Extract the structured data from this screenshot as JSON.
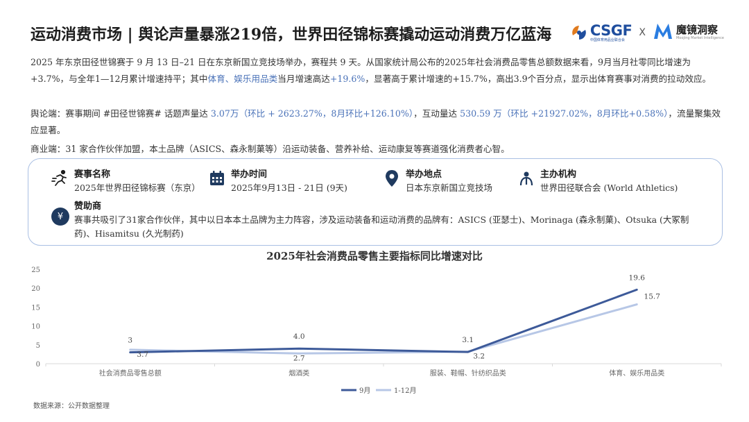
{
  "header": {
    "title": "运动消费市场 | 舆论声量暴涨219倍，世界田径锦标赛撬动运动消费万亿蓝海",
    "logo_csgf": "CSGF",
    "logo_csgf_sub": "中国体育用品业联合会",
    "logo_x": "X",
    "logo_moojing": "魔镜洞察",
    "logo_moojing_sub": "Moojing Market Intelligence",
    "brand_color": "#1f4e9e"
  },
  "paragraphs": {
    "p1_a": "2025 年东京田径世锦赛于 9 月 13 日–21 日在东京新国立竞技场举办，赛程共 9 天。从国家统计局公布的2025年社会消费品零售总额数据来看，9月当月社零同比增速为+3.7%，与全年1—12月累计增速持平；其中",
    "p1_hl1": "体育、娱乐用品类",
    "p1_b": "当月增速高达",
    "p1_hl2": "+19.6%",
    "p1_c": "，显著高于累计增速的+15.7%，高出3.9个百分点，显示出体育赛事对消费的拉动效应。",
    "p2_a": "舆论端：赛事期间 #田径世锦赛# 话题声量达 ",
    "p2_hl1": "3.07万（环比 + 2623.27%，8月环比+126.10%）",
    "p2_b": "，互动量达 ",
    "p2_hl2": "530.59 万（环比 +21927.02%，8月环比+0.58%）",
    "p2_c": "，流量聚集效应显著。",
    "p3": "商业端：31 家合作伙伴加盟，本土品牌（ASICS、森永制菓等）沿运动装备、营养补给、运动康复等赛道强化消费者心智。",
    "highlight_color": "#4a72b8"
  },
  "info": {
    "event_label": "赛事名称",
    "event_value": "2025年世界田径锦标赛（东京）",
    "time_label": "举办时间",
    "time_value": "2025年9月13日 - 21日 (9天)",
    "place_label": "举办地点",
    "place_value": "日本东京新国立竞技场",
    "org_label": "主办机构",
    "org_value": "世界田径联合会 (World Athletics)",
    "sponsor_label": "赞助商",
    "sponsor_value": "赛事共吸引了31家合作伙伴，其中以日本本土品牌为主力阵容，涉及运动装备和运动消费的品牌有：ASICS (亚瑟士)、Morinaga (森永制菓)、Otsuka (大冢制药)、Hisamitsu (久光制药)",
    "icons": [
      "runner-icon",
      "calendar-icon",
      "location-pin-icon",
      "organization-icon",
      "yen-icon"
    ],
    "border_color": "#a9bfe3"
  },
  "chart_data": {
    "type": "line",
    "title": "2025年社会消费品零售主要指标同比增速对比",
    "categories": [
      "社会消费品零售总额",
      "烟酒类",
      "服装、鞋帽、针纺织品类",
      "体育、娱乐用品类"
    ],
    "series": [
      {
        "name": "9月",
        "values": [
          3,
          4.0,
          3.1,
          19.6
        ],
        "labels": [
          "3",
          "4.0",
          "3.1",
          "19.6"
        ],
        "color": "#3d5a99"
      },
      {
        "name": "1-12月",
        "values": [
          3.7,
          2.7,
          3.2,
          15.7
        ],
        "labels": [
          "3.7",
          "2.7",
          "3.2",
          "15.7"
        ],
        "color": "#b7c7e6"
      }
    ],
    "ylim": [
      0,
      25
    ],
    "yticks": [
      0,
      5,
      10,
      15,
      20,
      25
    ],
    "grid": false,
    "legend": "bottom-center",
    "xlabel": "",
    "ylabel": ""
  },
  "footer": {
    "source": "数据来源：公开数据整理"
  }
}
